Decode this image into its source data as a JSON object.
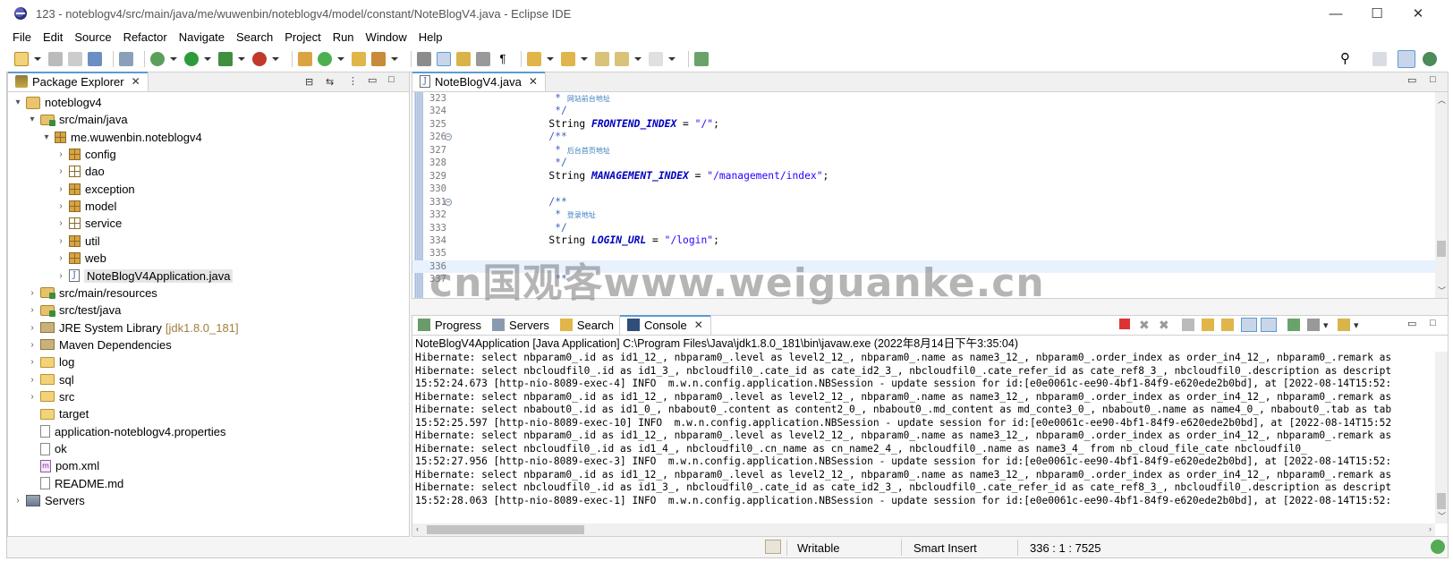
{
  "window": {
    "title": "123 - noteblogv4/src/main/java/me/wuwenbin/noteblogv4/model/constant/NoteBlogV4.java - Eclipse IDE",
    "minimize": "—",
    "maximize": "☐",
    "close": "✕"
  },
  "menu": [
    "File",
    "Edit",
    "Source",
    "Refactor",
    "Navigate",
    "Search",
    "Project",
    "Run",
    "Window",
    "Help"
  ],
  "package_explorer": {
    "tab_label": "Package Explorer",
    "tree": [
      {
        "label": "noteblogv4",
        "icon": "project-icon",
        "twisty": "▾"
      },
      {
        "label": "src/main/java",
        "icon": "source-folder-icon",
        "twisty": "▾"
      },
      {
        "label": "me.wuwenbin.noteblogv4",
        "icon": "package-icon",
        "twisty": "▾"
      },
      {
        "label": "config",
        "icon": "package-icon",
        "twisty": "›"
      },
      {
        "label": "dao",
        "icon": "package-icon",
        "twisty": "›"
      },
      {
        "label": "exception",
        "icon": "package-icon",
        "twisty": "›"
      },
      {
        "label": "model",
        "icon": "package-icon",
        "twisty": "›"
      },
      {
        "label": "service",
        "icon": "package-icon",
        "twisty": "›"
      },
      {
        "label": "util",
        "icon": "package-icon",
        "twisty": "›"
      },
      {
        "label": "web",
        "icon": "package-icon",
        "twisty": "›"
      },
      {
        "label": "NoteBlogV4Application.java",
        "icon": "java-file-icon",
        "twisty": "›"
      },
      {
        "label": "src/main/resources",
        "icon": "source-folder-icon",
        "twisty": "›"
      },
      {
        "label": "src/test/java",
        "icon": "source-folder-icon",
        "twisty": "›"
      },
      {
        "label": "JRE System Library",
        "decoration": "[jdk1.8.0_181]",
        "icon": "library-icon",
        "twisty": "›"
      },
      {
        "label": "Maven Dependencies",
        "icon": "library-icon",
        "twisty": "›"
      },
      {
        "label": "log",
        "icon": "folder-icon",
        "twisty": "›"
      },
      {
        "label": "sql",
        "icon": "folder-icon",
        "twisty": "›"
      },
      {
        "label": "src",
        "icon": "folder-icon",
        "twisty": "›"
      },
      {
        "label": "target",
        "icon": "folder-icon",
        "twisty": ""
      },
      {
        "label": "application-noteblogv4.properties",
        "icon": "file-icon",
        "twisty": ""
      },
      {
        "label": "ok",
        "icon": "file-icon",
        "twisty": ""
      },
      {
        "label": "pom.xml",
        "icon": "pom-icon",
        "twisty": ""
      },
      {
        "label": "README.md",
        "icon": "file-icon",
        "twisty": ""
      },
      {
        "label": "Servers",
        "icon": "servers-icon",
        "twisty": "›"
      }
    ]
  },
  "editor": {
    "tab_label": "NoteBlogV4.java",
    "lines": [
      {
        "num": "323",
        "parts": [
          {
            "t": "         * ",
            "c": "cmt"
          },
          {
            "t": "网站前台地址",
            "c": "cmt-cn"
          }
        ]
      },
      {
        "num": "324",
        "parts": [
          {
            "t": "         */",
            "c": "cmt"
          }
        ]
      },
      {
        "num": "325",
        "parts": [
          {
            "t": "        String ",
            "c": "kw-type"
          },
          {
            "t": "FRONTEND_INDEX",
            "c": "const"
          },
          {
            "t": " = ",
            "c": "kw-type"
          },
          {
            "t": "\"/\"",
            "c": "str"
          },
          {
            "t": ";",
            "c": "kw-type"
          }
        ]
      },
      {
        "num": "326",
        "fold": "⊖",
        "parts": [
          {
            "t": "        /**",
            "c": "cmt"
          }
        ]
      },
      {
        "num": "327",
        "parts": [
          {
            "t": "         * ",
            "c": "cmt"
          },
          {
            "t": "后台首页地址",
            "c": "cmt-cn"
          }
        ]
      },
      {
        "num": "328",
        "parts": [
          {
            "t": "         */",
            "c": "cmt"
          }
        ]
      },
      {
        "num": "329",
        "parts": [
          {
            "t": "        String ",
            "c": "kw-type"
          },
          {
            "t": "MANAGEMENT_INDEX",
            "c": "const"
          },
          {
            "t": " = ",
            "c": "kw-type"
          },
          {
            "t": "\"/management/index\"",
            "c": "str"
          },
          {
            "t": ";",
            "c": "kw-type"
          }
        ]
      },
      {
        "num": "330",
        "parts": []
      },
      {
        "num": "331",
        "fold": "⊖",
        "parts": [
          {
            "t": "        /**",
            "c": "cmt"
          }
        ]
      },
      {
        "num": "332",
        "parts": [
          {
            "t": "         * ",
            "c": "cmt"
          },
          {
            "t": "登录地址",
            "c": "cmt-cn"
          }
        ]
      },
      {
        "num": "333",
        "parts": [
          {
            "t": "         */",
            "c": "cmt"
          }
        ]
      },
      {
        "num": "334",
        "parts": [
          {
            "t": "        String ",
            "c": "kw-type"
          },
          {
            "t": "LOGIN_URL",
            "c": "const"
          },
          {
            "t": " = ",
            "c": "kw-type"
          },
          {
            "t": "\"/login\"",
            "c": "str"
          },
          {
            "t": ";",
            "c": "kw-type"
          }
        ]
      },
      {
        "num": "335",
        "parts": []
      },
      {
        "num": "336",
        "current": true,
        "parts": []
      },
      {
        "num": "337",
        "parts": [
          {
            "t": "         **",
            "c": "cmt"
          }
        ]
      }
    ],
    "watermark": "cn国观客www.weiguanke.cn"
  },
  "bottom_panel": {
    "tabs": [
      {
        "label": "Progress",
        "icon": "progress-icon"
      },
      {
        "label": "Servers",
        "icon": "servers-icon"
      },
      {
        "label": "Search",
        "icon": "search-icon"
      },
      {
        "label": "Console",
        "icon": "console-icon",
        "active": true
      }
    ],
    "console_header": "NoteBlogV4Application [Java Application] C:\\Program Files\\Java\\jdk1.8.0_181\\bin\\javaw.exe  (2022年8月14日下午3:35:04)",
    "console_lines": [
      "Hibernate: select nbparam0_.id as id1_12_, nbparam0_.level as level2_12_, nbparam0_.name as name3_12_, nbparam0_.order_index as order_in4_12_, nbparam0_.remark as",
      "Hibernate: select nbcloudfil0_.id as id1_3_, nbcloudfil0_.cate_id as cate_id2_3_, nbcloudfil0_.cate_refer_id as cate_ref8_3_, nbcloudfil0_.description as descript",
      "15:52:24.673 [http-nio-8089-exec-4] INFO  m.w.n.config.application.NBSession - update session for id:[e0e0061c-ee90-4bf1-84f9-e620ede2b0bd], at [2022-08-14T15:52:",
      "Hibernate: select nbparam0_.id as id1_12_, nbparam0_.level as level2_12_, nbparam0_.name as name3_12_, nbparam0_.order_index as order_in4_12_, nbparam0_.remark as",
      "Hibernate: select nbabout0_.id as id1_0_, nbabout0_.content as content2_0_, nbabout0_.md_content as md_conte3_0_, nbabout0_.name as name4_0_, nbabout0_.tab as tab",
      "15:52:25.597 [http-nio-8089-exec-10] INFO  m.w.n.config.application.NBSession - update session for id:[e0e0061c-ee90-4bf1-84f9-e620ede2b0bd], at [2022-08-14T15:52",
      "Hibernate: select nbparam0_.id as id1_12_, nbparam0_.level as level2_12_, nbparam0_.name as name3_12_, nbparam0_.order_index as order_in4_12_, nbparam0_.remark as",
      "Hibernate: select nbcloudfil0_.id as id1_4_, nbcloudfil0_.cn_name as cn_name2_4_, nbcloudfil0_.name as name3_4_ from nb_cloud_file_cate nbcloudfil0_",
      "15:52:27.956 [http-nio-8089-exec-3] INFO  m.w.n.config.application.NBSession - update session for id:[e0e0061c-ee90-4bf1-84f9-e620ede2b0bd], at [2022-08-14T15:52:",
      "Hibernate: select nbparam0_.id as id1_12_, nbparam0_.level as level2_12_, nbparam0_.name as name3_12_, nbparam0_.order_index as order_in4_12_, nbparam0_.remark as",
      "Hibernate: select nbcloudfil0_.id as id1_3_, nbcloudfil0_.cate_id as cate_id2_3_, nbcloudfil0_.cate_refer_id as cate_ref8_3_, nbcloudfil0_.description as descript",
      "15:52:28.063 [http-nio-8089-exec-1] INFO  m.w.n.config.application.NBSession - update session for id:[e0e0061c-ee90-4bf1-84f9-e620ede2b0bd], at [2022-08-14T15:52:"
    ]
  },
  "status": {
    "writable": "Writable",
    "insert_mode": "Smart Insert",
    "position": "336 : 1 : 7525"
  },
  "colors": {
    "accent": "#5b9bd5",
    "comment": "#3f5fbf",
    "string": "#2a00ff",
    "constant": "#0000c0"
  }
}
